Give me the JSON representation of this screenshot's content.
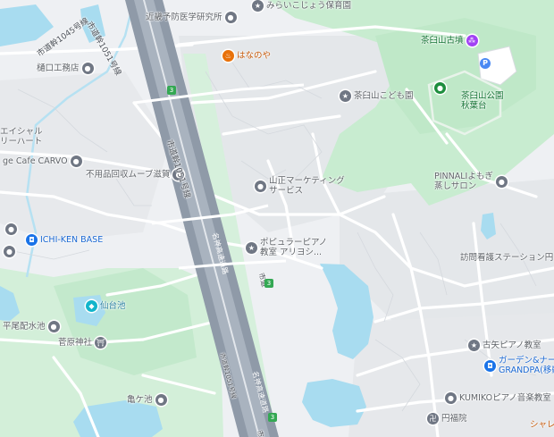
{
  "pois": [
    {
      "id": "kinki-yobo",
      "label": "近畿予防医学研究所",
      "icon": "search-pin-icon",
      "color": "gray"
    },
    {
      "id": "mirai",
      "label": "みらいこじょう保育園",
      "icon": "school-icon",
      "color": "gray"
    },
    {
      "id": "hananoya",
      "label": "はなのや",
      "icon": "restaurant-icon",
      "color": "orange"
    },
    {
      "id": "chausuyama-kofun",
      "label": "茶臼山古墳",
      "icon": "landmark-icon",
      "color": "green"
    },
    {
      "id": "higuchi",
      "label": "樋口工務店",
      "icon": "search-pin-icon",
      "color": "gray"
    },
    {
      "id": "chausuyama-kodomoen",
      "label": "茶臼山こども園",
      "icon": "school-icon",
      "color": "gray"
    },
    {
      "id": "chausuyama-park",
      "label": "茶臼山公園",
      "label2": "秋葉台",
      "icon": "park-icon",
      "color": "green"
    },
    {
      "id": "social",
      "label": "エイシャル",
      "label2": "リーハート",
      "icon": "",
      "color": "gray"
    },
    {
      "id": "cafe-carvo",
      "label": "ge Cafe CARVO",
      "icon": "search-pin-icon",
      "color": "gray"
    },
    {
      "id": "fuyouhin",
      "label": "不用品回収ムーブ滋賀",
      "icon": "search-pin-icon",
      "color": "gray"
    },
    {
      "id": "pinnali",
      "label": "PINNALIよもぎ",
      "label2": "蒸しサロン",
      "icon": "search-pin-icon",
      "color": "gray"
    },
    {
      "id": "yamamasa",
      "label": "山正マーケティング",
      "label2": "サービス",
      "icon": "search-pin-icon",
      "color": "gray"
    },
    {
      "id": "ichiken",
      "label": "ICHI-KEN BASE",
      "icon": "shopping-bag-icon",
      "color": "blue"
    },
    {
      "id": "popular-piano",
      "label": "ポピュラーピアノ",
      "label2": "教室 アリヨシ...",
      "icon": "star-icon",
      "color": "gray"
    },
    {
      "id": "houmon",
      "label": "訪問看護ステーション円",
      "icon": "",
      "color": "gray"
    },
    {
      "id": "sendaiike",
      "label": "仙台池",
      "icon": "water-icon",
      "color": "teal"
    },
    {
      "id": "hirao",
      "label": "平尾配水池",
      "icon": "search-pin-icon",
      "color": "gray"
    },
    {
      "id": "sugawara",
      "label": "菅原神社",
      "icon": "shrine-icon",
      "color": "gray"
    },
    {
      "id": "furuya-piano",
      "label": "古矢ピアノ教室",
      "icon": "star-icon",
      "color": "gray"
    },
    {
      "id": "garden",
      "label": "ガーデン&ナー",
      "label2": "GRANDPA(移動",
      "icon": "shopping-bag-icon",
      "color": "blue"
    },
    {
      "id": "kamegaike",
      "label": "亀ケ池",
      "icon": "search-pin-icon",
      "color": "gray"
    },
    {
      "id": "kumiko",
      "label": "KUMIKOピアノ音楽教室",
      "icon": "search-pin-icon",
      "color": "gray"
    },
    {
      "id": "enpukuin",
      "label": "円福院",
      "icon": "temple-icon",
      "color": "gray"
    },
    {
      "id": "shareo",
      "label": "シャレ",
      "icon": "",
      "color": "orange"
    }
  ],
  "roads": [
    {
      "id": "r1045",
      "label": "市道幹1045号線"
    },
    {
      "id": "r1051-top",
      "label": "市道幹1051号線"
    },
    {
      "id": "r1051-mid",
      "label": "市道幹1051号線"
    },
    {
      "id": "r1051-low",
      "label": "市道幹1051号線"
    },
    {
      "id": "r-highway-1",
      "label": "名神高速道路"
    },
    {
      "id": "r-highway-2",
      "label": "名神高速道路"
    },
    {
      "id": "r-city",
      "label": "市道"
    },
    {
      "id": "r-bottom",
      "label": "市道"
    }
  ],
  "shields": [
    "3",
    "3",
    "3"
  ],
  "parking": "P",
  "colors": {
    "water": "#a8dcf0",
    "park": "#c8ecd0",
    "park_dark": "#a9dfb5",
    "highway": "#8f9aa8",
    "land": "#eef0f3"
  }
}
